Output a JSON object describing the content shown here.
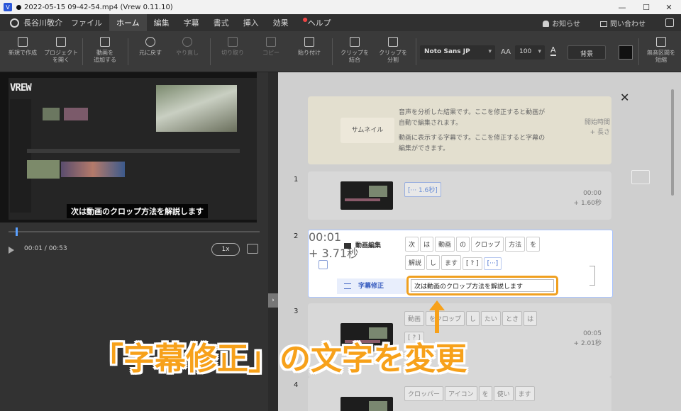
{
  "window": {
    "title": "2022-05-15 09-42-54.mp4 (Vrew 0.11.10)",
    "app_icon": "V"
  },
  "menu": {
    "user": "長谷川敬介",
    "items": [
      "ファイル",
      "ホーム",
      "編集",
      "字幕",
      "書式",
      "挿入",
      "効果",
      "ヘルプ"
    ],
    "active": "ホーム",
    "notifications": "お知らせ",
    "contact": "問い合わせ"
  },
  "toolbar": {
    "new_project": "新規で作成",
    "open_project_1": "プロジェクト",
    "open_project_2": "を開く",
    "add_video_1": "動画を",
    "add_video_2": "追加する",
    "undo": "元に戻す",
    "redo": "やり直し",
    "cut": "切り取り",
    "copy": "コピー",
    "paste": "貼り付け",
    "merge_1": "クリップを",
    "merge_2": "結合",
    "split_1": "クリップを",
    "split_2": "分割",
    "font": "Noto Sans JP",
    "font_size": "100",
    "background": "背景",
    "shorten_1": "無音区間を",
    "shorten_2": "短縮"
  },
  "player": {
    "logo": "VREW",
    "caption": "次は動画のクロップ方法を解説します",
    "time": "00:01 / 00:53",
    "speed": "1x"
  },
  "help": {
    "thumbnail": "サムネイル",
    "text1": "音声を分析した結果です。ここを修正すると動画が自動で編集されます。",
    "text2": "動画に表示する字幕です。ここを修正すると字幕の編集ができます。",
    "meta1": "開始時間",
    "meta2": "+ 長さ"
  },
  "clips": [
    {
      "num": "1",
      "words": [
        "[··· 1.6秒]"
      ],
      "start": "00:00",
      "length": "+ 1.60秒"
    },
    {
      "num": "2",
      "label_edit": "動画編集",
      "label_sub": "字幕修正",
      "words": [
        "次",
        "は",
        "動画",
        "の",
        "クロップ",
        "方法",
        "を",
        "解説",
        "し",
        "ます",
        "[ ? ]",
        "[···]"
      ],
      "subtitle": "次は動画のクロップ方法を解説します",
      "start": "00:01",
      "length": "+ 3.71秒"
    },
    {
      "num": "3",
      "words": [
        "動画",
        "をクロップ",
        "し",
        "たい",
        "とき",
        "は",
        "[ ? ]"
      ],
      "start": "00:05",
      "length": "+ 2.01秒"
    },
    {
      "num": "4",
      "words": [
        "クロッパー",
        "アイコン",
        "を",
        "使い",
        "ます"
      ]
    }
  ],
  "annotation": "「字幕修正」の文字を変更",
  "colors": {
    "accent": "#f7a11a",
    "highlight": "#4b73d0"
  }
}
